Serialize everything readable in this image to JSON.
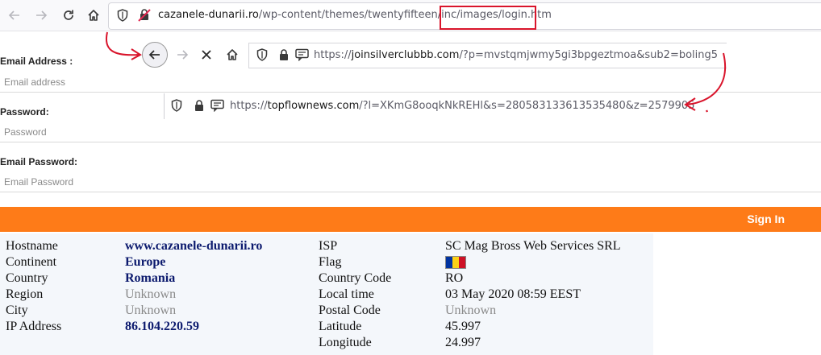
{
  "browser1": {
    "url_domain": "cazanele-dunarii.ro",
    "url_path": "/wp-content/themes/twentyfifteen/inc/images/login.htm"
  },
  "browser2": {
    "url_prefix": "https://",
    "url_domain": "joinsilverclubbb.com",
    "url_path": "/?p=mvstqmjwmy5gi3bpgeztmoa&sub2=boling5"
  },
  "browser3": {
    "url_prefix": "https://",
    "url_domain": "topflownews.com",
    "url_path": "/?l=XKmG8ooqkNkREHl&s=280583133613535480&z=2579905"
  },
  "form": {
    "email_label": "Email Address :",
    "email_placeholder": "Email address",
    "password_label": "Password:",
    "password_placeholder": "Password",
    "email_password_label": "Email Password:",
    "email_password_placeholder": "Email Password",
    "signin_label": "Sign In"
  },
  "info": {
    "hostname_label": "Hostname",
    "hostname": "www.cazanele-dunarii.ro",
    "continent_label": "Continent",
    "continent": "Europe",
    "country_label": "Country",
    "country": "Romania",
    "region_label": "Region",
    "region": "Unknown",
    "city_label": "City",
    "city": "Unknown",
    "ip_label": "IP Address",
    "ip": "86.104.220.59",
    "isp_label": "ISP",
    "isp": "SC Mag Bross Web Services SRL",
    "flag_label": "Flag",
    "country_code_label": "Country Code",
    "country_code": "RO",
    "local_time_label": "Local time",
    "local_time": "03 May 2020 08:59 EEST",
    "postal_code_label": "Postal Code",
    "postal_code": "Unknown",
    "latitude_label": "Latitude",
    "latitude": "45.997",
    "longitude_label": "Longitude",
    "longitude": "24.997"
  },
  "colors": {
    "accent_orange": "#fe7b18",
    "annotation_red": "#d9142b",
    "value_navy": "#0c1a6e"
  },
  "icons": [
    "back-arrow-icon",
    "forward-arrow-icon",
    "reload-icon",
    "stop-icon",
    "home-icon",
    "shield-icon",
    "lock-icon",
    "permissions-icon",
    "insecure-lock-icon",
    "romania-flag-icon"
  ]
}
